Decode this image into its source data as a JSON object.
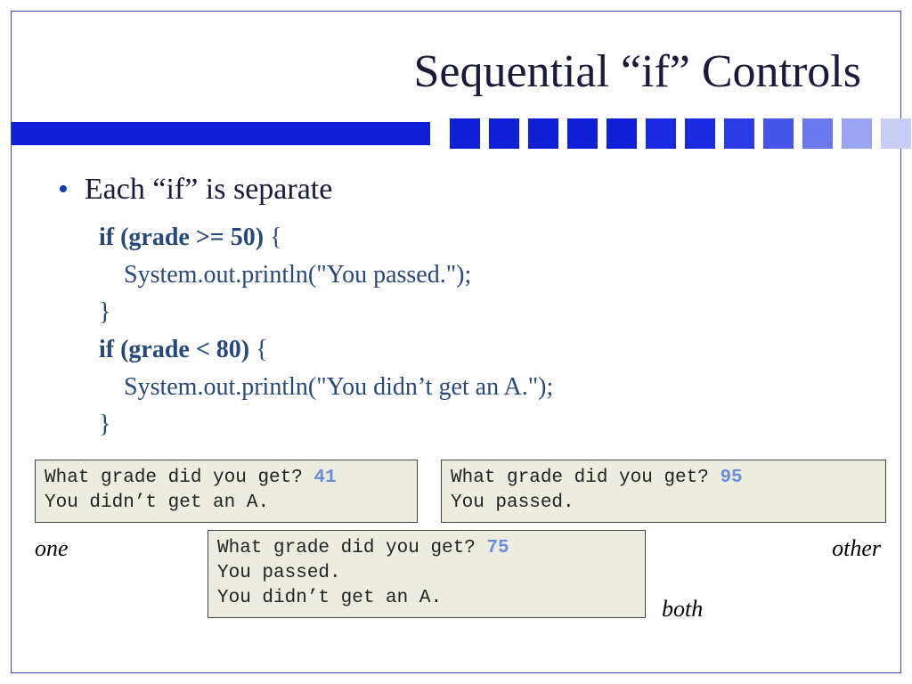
{
  "title": "Sequential “if” Controls",
  "bullet": "Each “if” is separate",
  "code": {
    "l1_kw": "if (grade >= 50)",
    "l1_brace": " {",
    "l2": "    System.out.println(\"You passed.\");",
    "l3": "}",
    "l4_kw": "if (grade < 80)",
    "l4_brace": " {",
    "l5": "    System.out.println(\"You didn’t get an A.\");",
    "l6": "}"
  },
  "output1": {
    "prompt": "What grade did you get? ",
    "num": "41",
    "line2": "You didn’t get an A."
  },
  "output2": {
    "prompt": "What grade did you get? ",
    "num": "95",
    "line2": "You passed."
  },
  "output3": {
    "prompt": "What grade did you get? ",
    "num": "75",
    "line2": "You passed.",
    "line3": "You didn’t get an A."
  },
  "labels": {
    "one": "one",
    "other": "other",
    "both": "both"
  },
  "stripe_colors": [
    "#0f1fd6",
    "#0f1fd6",
    "#0f1fd6",
    "#0f1fd6",
    "#0f1fd6",
    "#1a2ae0",
    "#1a2ae0",
    "#2b3be6",
    "#4555ea",
    "#6a78ee",
    "#9aa4f2",
    "#c8cdf6",
    "#e6e9fa"
  ]
}
